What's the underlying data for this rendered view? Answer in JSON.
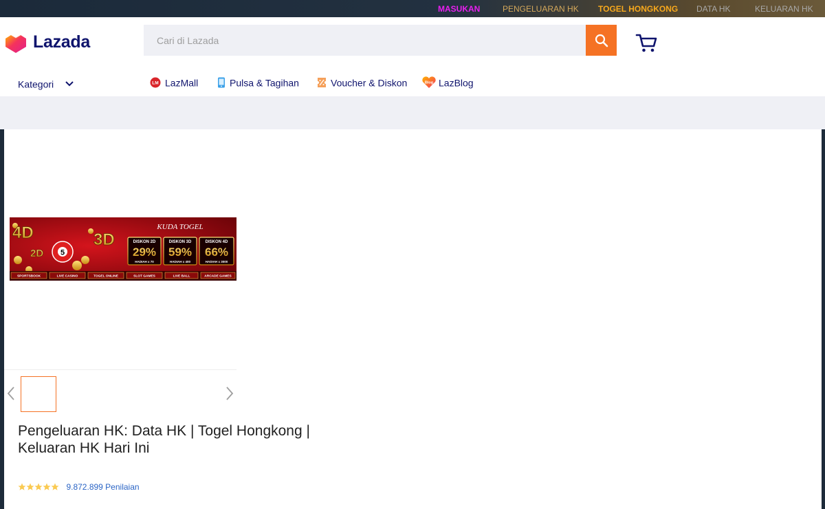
{
  "topbar": {
    "links": [
      {
        "label": "MASUKAN",
        "color": "#e81ff0"
      },
      {
        "label": "PENGELUARAN HK",
        "color": "#d4a85b"
      },
      {
        "label": "TOGEL HONGKONG",
        "color": "#f8a91c"
      },
      {
        "label": "DATA HK",
        "color": "#a9a9a9"
      },
      {
        "label": "KELUARAN HK",
        "color": "#a9a9a9"
      }
    ]
  },
  "header": {
    "logo_text": "Lazada",
    "search": {
      "placeholder": "Cari di Lazada",
      "value": ""
    },
    "search_button_icon": "search-icon",
    "cart_icon": "cart-icon"
  },
  "nav": {
    "kategori_label": "Kategori",
    "items": [
      {
        "label": "LazMall",
        "icon": "lazmall-icon"
      },
      {
        "label": "Pulsa & Tagihan",
        "icon": "phone-icon"
      },
      {
        "label": "Voucher & Diskon",
        "icon": "voucher-icon"
      },
      {
        "label": "LazBlog",
        "icon": "lazblog-icon"
      }
    ]
  },
  "banner": {
    "brand": "KUDA TOGEL",
    "promos": [
      {
        "heading": "DISKON 2D",
        "value": "29%",
        "prize": "HADIAH x 70"
      },
      {
        "heading": "DISKON 3D",
        "value": "59%",
        "prize": "HADIAH x 400"
      },
      {
        "heading": "DISKON 4D",
        "value": "66%",
        "prize": "HADIAH x 3000"
      }
    ],
    "categories": [
      "SPORTSBOOK",
      "LIVE CASINO",
      "TOGEL ONLINE",
      "SLOT GAMES",
      "LIVE BALL",
      "ARCADE GAMES"
    ],
    "badges": [
      "4D",
      "2D",
      "3D",
      "5"
    ]
  },
  "product": {
    "title": "Pengeluaran HK: Data HK | Togel Hongkong | Keluaran HK Hari Ini",
    "rating_stars": 5,
    "rating_count": "9.872.899 Penilaian"
  },
  "colors": {
    "accent": "#f57224",
    "brand_navy": "#0f146d",
    "link_blue": "#2a64c5",
    "star": "#faca51"
  }
}
